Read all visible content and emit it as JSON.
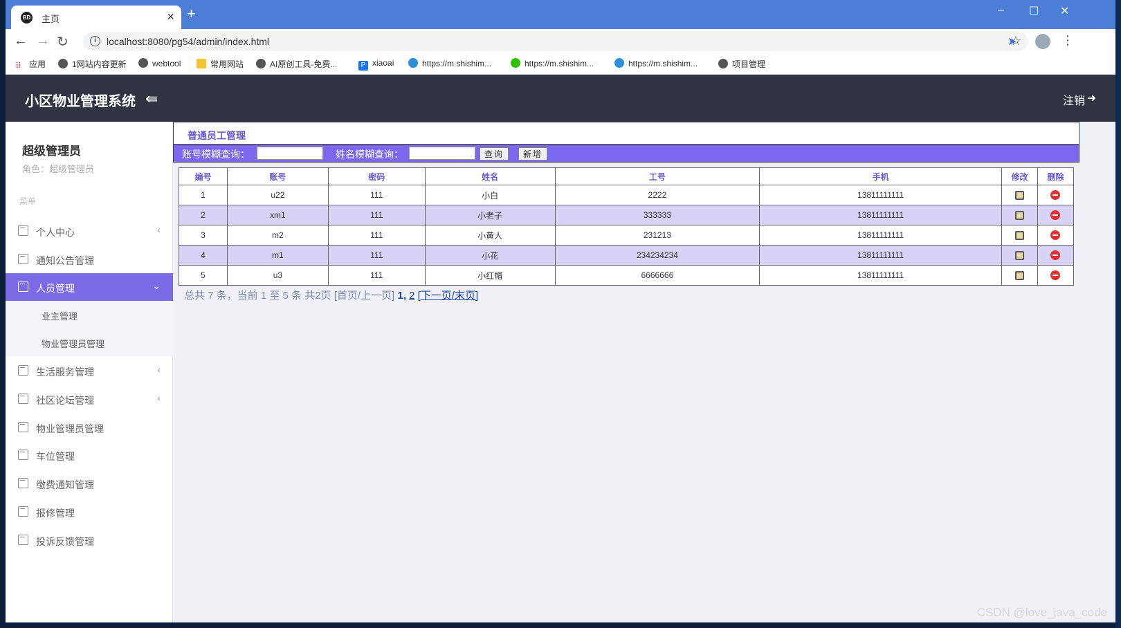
{
  "browser": {
    "tab_title": "主页",
    "tab_favicon_text": "BD",
    "url": "localhost:8080/pg54/admin/index.html",
    "bookmarks": [
      {
        "label": "应用",
        "icon": "apps-icon"
      },
      {
        "label": "1网站内容更新",
        "icon": "globe-icon"
      },
      {
        "label": "webtool",
        "icon": "globe-icon"
      },
      {
        "label": "常用网站",
        "icon": "folder-icon"
      },
      {
        "label": "AI原创工具-免费...",
        "icon": "globe-icon"
      },
      {
        "label": "xiaoai",
        "icon": "p-icon"
      },
      {
        "label": "https://m.shishim...",
        "icon": "c-icon"
      },
      {
        "label": "https://m.shishim...",
        "icon": "wechat-icon"
      },
      {
        "label": "https://m.shishim...",
        "icon": "c-icon"
      },
      {
        "label": "项目管理",
        "icon": "globe-icon"
      }
    ]
  },
  "header": {
    "title": "小区物业管理系统",
    "logout_label": "注销"
  },
  "sidebar": {
    "user_name": "超级管理员",
    "user_role": "角色：超级管理员",
    "menu_label": "菜单",
    "items": [
      {
        "label": "个人中心",
        "chevron": "‹"
      },
      {
        "label": "通知公告管理",
        "chevron": ""
      },
      {
        "label": "人员管理",
        "chevron": "⌄"
      },
      {
        "label": "生活服务管理",
        "chevron": "‹"
      },
      {
        "label": "社区论坛管理",
        "chevron": "‹"
      },
      {
        "label": "物业管理员管理",
        "chevron": ""
      },
      {
        "label": "车位管理",
        "chevron": ""
      },
      {
        "label": "缴费通知管理",
        "chevron": ""
      },
      {
        "label": "报修管理",
        "chevron": ""
      },
      {
        "label": "投诉反馈管理",
        "chevron": ""
      }
    ],
    "subitems": [
      "业主管理",
      "物业管理员管理"
    ]
  },
  "main": {
    "panel_title": "普通员工管理",
    "search": {
      "account_label": "账号模糊查询：",
      "account_value": "",
      "name_label": "姓名模糊查询：",
      "name_value": "",
      "query_button": "查询",
      "add_button": "新增"
    },
    "table": {
      "headers": [
        "编号",
        "账号",
        "密码",
        "姓名",
        "工号",
        "手机",
        "修改",
        "删除"
      ],
      "rows": [
        [
          "1",
          "u22",
          "111",
          "小白",
          "2222",
          "13811111111"
        ],
        [
          "2",
          "xm1",
          "111",
          "小老子",
          "333333",
          "13811111111"
        ],
        [
          "3",
          "m2",
          "111",
          "小黄人",
          "231213",
          "13811111111"
        ],
        [
          "4",
          "m1",
          "111",
          "小花",
          "234234234",
          "13811111111"
        ],
        [
          "5",
          "u3",
          "111",
          "小红帽",
          "6666666",
          "13811111111"
        ]
      ]
    },
    "pager": {
      "summary": "总共 7 条，当前 1 至 5 条 共2页",
      "first_prev": "[首页/上一页]",
      "page1": "1",
      "sep": ",",
      "page2": "2",
      "next_last_open": "[",
      "next": "下一页",
      "slash": "/",
      "last": "末页",
      "next_last_close": "]"
    }
  },
  "watermark": "CSDN @love_java_code",
  "colors": {
    "header_bg": "#2f3440",
    "accent": "#7b68ee",
    "active_menu": "#7c6be6",
    "alt_row": "#d8d2f6",
    "delete": "#e03030"
  }
}
